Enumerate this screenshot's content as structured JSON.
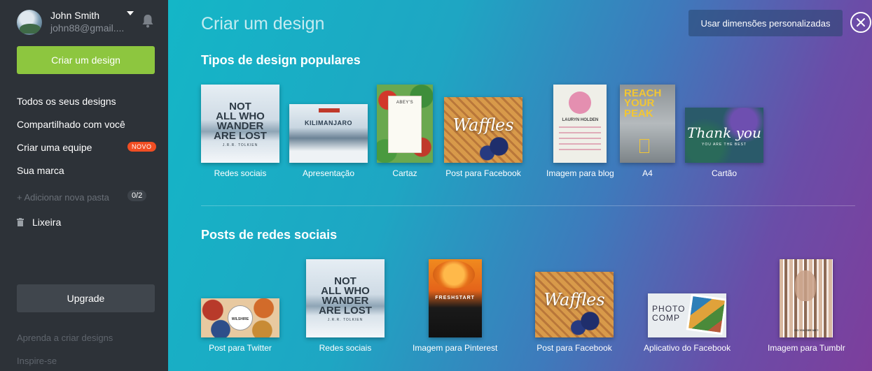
{
  "user": {
    "name": "John Smith",
    "email": "john88@gmail...."
  },
  "sidebar": {
    "create_label": "Criar um design",
    "nav": [
      {
        "label": "Todos os seus designs"
      },
      {
        "label": "Compartilhado com você"
      },
      {
        "label": "Criar uma equipe",
        "badge": "NOVO"
      },
      {
        "label": "Sua marca"
      }
    ],
    "add_folder": "+ Adicionar nova pasta",
    "folder_count": "0/2",
    "trash": "Lixeira",
    "upgrade": "Upgrade",
    "learn": "Aprenda a criar designs",
    "inspire": "Inspire-se"
  },
  "main": {
    "title": "Criar um design",
    "custom_dimensions": "Usar dimensões personalizadas",
    "popular_title": "Tipos de design populares",
    "social_title": "Posts de redes sociais",
    "popular": [
      {
        "label": "Redes sociais",
        "thumb_text": [
          "NOT",
          "ALL WHO",
          "WANDER",
          "ARE LOST"
        ],
        "thumb_sub": "J.R.R. TOLKIEN"
      },
      {
        "label": "Apresentação",
        "thumb_text": "KILIMANJARO"
      },
      {
        "label": "Cartaz",
        "thumb_text": "ABEY'S"
      },
      {
        "label": "Post para Facebook",
        "thumb_text": "Waffles"
      },
      {
        "label": "Imagem para blog",
        "thumb_text": "LAURYN HOLDEN"
      },
      {
        "label": "A4",
        "thumb_text": [
          "REACH",
          "YOUR",
          "PEAK"
        ]
      },
      {
        "label": "Cartão",
        "thumb_text": "Thank you",
        "thumb_sub": "YOU ARE THE BEST"
      }
    ],
    "social": [
      {
        "label": "Post para Twitter",
        "thumb_text": "WILSHIRE"
      },
      {
        "label": "Redes sociais",
        "thumb_text": [
          "NOT",
          "ALL WHO",
          "WANDER",
          "ARE LOST"
        ],
        "thumb_sub": "J.R.R. TOLKIEN"
      },
      {
        "label": "Imagem para Pinterest",
        "thumb_text": "FRESHSTART"
      },
      {
        "label": "Post para Facebook",
        "thumb_text": "Waffles"
      },
      {
        "label": "Aplicativo do Facebook",
        "thumb_text": [
          "PHOTO",
          "COMP"
        ]
      },
      {
        "label": "Imagem para Tumblr",
        "thumb_text": "DO YOU SEE ME?"
      }
    ]
  },
  "colors": {
    "sidebar_bg": "#2d3238",
    "create_btn": "#8dc63f",
    "badge_new": "#f04e23",
    "main_gradient_start": "#14b6c7",
    "main_gradient_end": "#7d3e9c"
  },
  "icons": {
    "bell": "bell-icon",
    "caret": "chevron-down-icon",
    "trash": "trash-icon",
    "close": "close-icon"
  }
}
